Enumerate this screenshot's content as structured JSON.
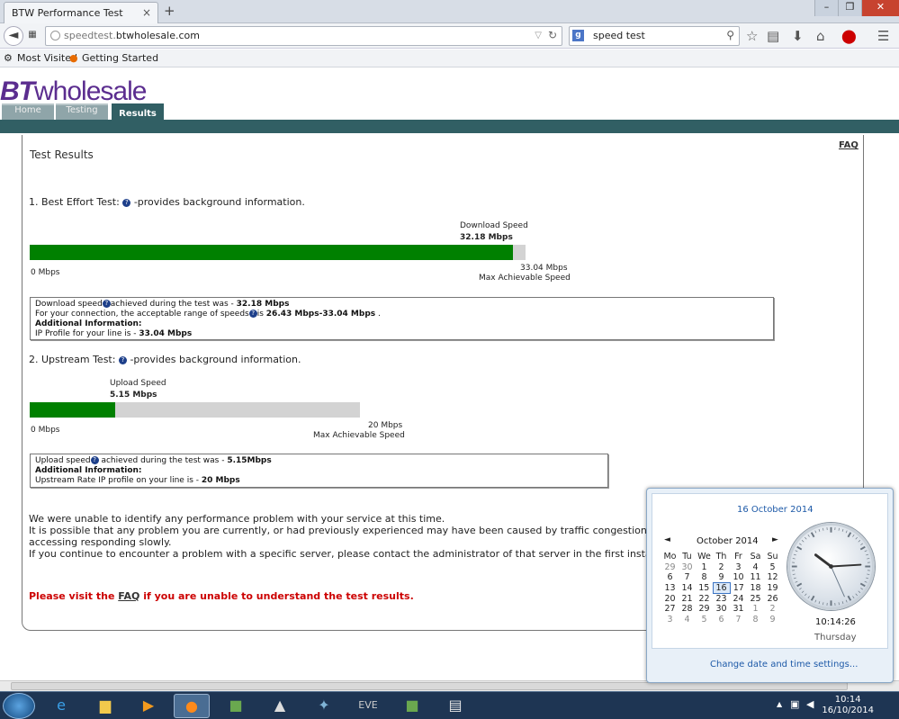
{
  "browser": {
    "tab_title": "BTW Performance Test",
    "tab_close": "×",
    "new_tab": "+",
    "url_prefix": "speedtest.",
    "url_domain": "btwholesale.com",
    "search_value": "speed test",
    "search_engine": "g",
    "bookmarks": [
      "Most Visited",
      "Getting Started"
    ],
    "window_controls": [
      "–",
      "❐",
      "✕"
    ]
  },
  "site": {
    "logo_bold": "BT",
    "logo_rest": "wholesale",
    "nav": [
      "Home",
      "Testing",
      "Results"
    ],
    "active_nav": "Results",
    "faq_label": "FAQ",
    "title": "Test Results",
    "brand_color": "#315f64",
    "bar_green": "#008000"
  },
  "best_effort": {
    "heading": "1. Best Effort Test:",
    "heading_tail": "-provides background information.",
    "speed_label": "Download Speed",
    "speed_value": "32.18 Mbps",
    "min_label": "0 Mbps",
    "max_value": "33.04 Mbps",
    "max_label": "Max Achievable Speed",
    "fill_fraction": 0.974,
    "info_line1_a": "Download speed",
    "info_line1_b": "achieved during the test was - ",
    "info_line1_val": "32.18 Mbps",
    "info_line2_a": "For your connection, the acceptable range of speeds",
    "info_line2_b": "is ",
    "info_line2_val": "26.43 Mbps-33.04 Mbps",
    "info_line2_end": " .",
    "info_line3": "Additional Information:",
    "info_line4_a": "IP Profile for your line is - ",
    "info_line4_val": "33.04 Mbps"
  },
  "upstream": {
    "heading": "2. Upstream Test:",
    "heading_tail": "-provides background information.",
    "speed_label": "Upload Speed",
    "speed_value": "5.15 Mbps",
    "min_label": "0 Mbps",
    "max_value": "20 Mbps",
    "max_label": "Max Achievable Speed",
    "fill_fraction": 0.2575,
    "info_line1_a": "Upload speed",
    "info_line1_b": " achieved during the test was - ",
    "info_line1_val": "5.15Mbps",
    "info_line2": "Additional Information:",
    "info_line3_a": "Upstream Rate IP profile on your line is - ",
    "info_line3_val": "20 Mbps"
  },
  "message": {
    "line1": "We were unable to identify any performance problem with your service at this time.",
    "line2": "It is possible that any problem you are currently, or had previously experienced may have been caused by traffic congestion on the",
    "line3": "accessing responding slowly.",
    "line4": "If you continue to encounter a problem with a specific server, please contact the administrator of that server in the first instance.",
    "visit_a": "Please visit the ",
    "visit_link": "FAQ",
    "visit_b": " if you are unable to understand the test results."
  },
  "calendar": {
    "long_date": "16 October 2014",
    "month": "October 2014",
    "prev": "◄",
    "next": "►",
    "weekdays": [
      "Mo",
      "Tu",
      "We",
      "Th",
      "Fr",
      "Sa",
      "Su"
    ],
    "weeks": [
      [
        "29",
        "30",
        "1",
        "2",
        "3",
        "4",
        "5"
      ],
      [
        "6",
        "7",
        "8",
        "9",
        "10",
        "11",
        "12"
      ],
      [
        "13",
        "14",
        "15",
        "16",
        "17",
        "18",
        "19"
      ],
      [
        "20",
        "21",
        "22",
        "23",
        "24",
        "25",
        "26"
      ],
      [
        "27",
        "28",
        "29",
        "30",
        "31",
        "1",
        "2"
      ],
      [
        "3",
        "4",
        "5",
        "6",
        "7",
        "8",
        "9"
      ]
    ],
    "today": "16",
    "clock_time": "10:14:26",
    "clock_day": "Thursday",
    "settings_link": "Change date and time settings...",
    "clock_hands": {
      "hours": 10,
      "minutes": 14,
      "seconds": 26
    }
  },
  "taskbar": {
    "time": "10:14",
    "date": "16/10/2014",
    "apps": [
      "internet-explorer-icon",
      "file-explorer-icon",
      "media-player-icon",
      "firefox-icon",
      "minecraft-icon",
      "launcher-icon",
      "game-icon",
      "eve-icon",
      "minecraft-icon",
      "notepad-icon"
    ]
  }
}
